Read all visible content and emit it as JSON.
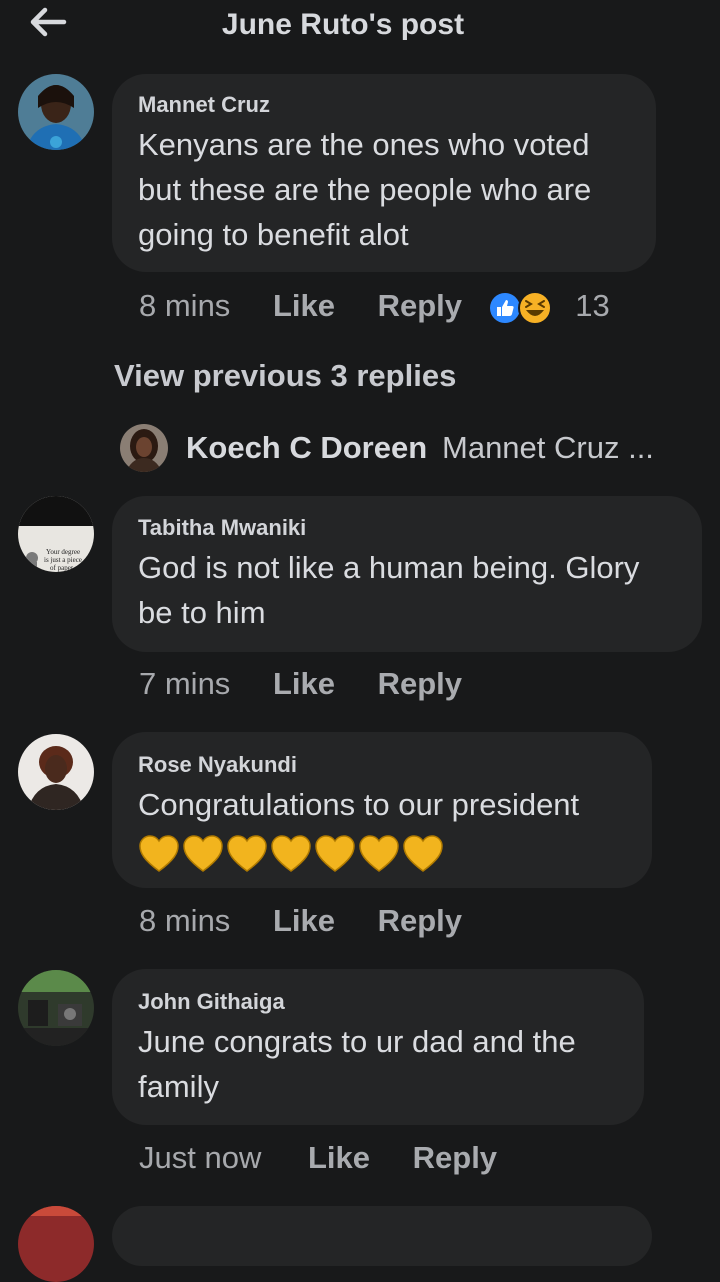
{
  "header": {
    "back_icon": "arrow-left-icon",
    "title": "June Ruto's post"
  },
  "comments": [
    {
      "author": "Mannet Cruz",
      "text": "Kenyans are the ones who voted but these are the people who are going to benefit alot",
      "lines": [
        "Kenyans are the ones who voted",
        "but these are the people who are",
        "going to benefit alot"
      ],
      "time": "8 mins",
      "like": "Like",
      "reply": "Reply",
      "reactions": {
        "icons": [
          "like-reaction-icon",
          "haha-reaction-icon"
        ],
        "count": "13"
      }
    },
    {
      "author": "Tabitha Mwaniki",
      "text": "God is not like a human being. Glory be to him",
      "lines": [
        "God is not like a human being. Glory",
        "be to him"
      ],
      "avatar_text": [
        "Your degree",
        "is just a piece",
        "of paper"
      ],
      "time": "7 mins",
      "like": "Like",
      "reply": "Reply"
    },
    {
      "author": "Rose Nyakundi",
      "text": "Congratulations to our president",
      "lines": [
        "Congratulations to our president"
      ],
      "emoji": {
        "icon": "yellow-heart-icon",
        "count": 7
      },
      "time": "8 mins",
      "like": "Like",
      "reply": "Reply"
    },
    {
      "author": "John Githaiga",
      "text": "June congrats to ur dad and the family",
      "lines": [
        "June congrats to ur dad and the",
        "family"
      ],
      "time": "Just now",
      "like": "Like",
      "reply": "Reply"
    }
  ],
  "thread": {
    "view_previous": "View previous 3 replies",
    "reply_author": "Koech C Doreen",
    "reply_preview": "Mannet Cruz ..."
  },
  "colors": {
    "background": "#18191a",
    "bubble": "#242526",
    "like_blue": "#2d88ff",
    "haha_yellow": "#f7b125"
  }
}
